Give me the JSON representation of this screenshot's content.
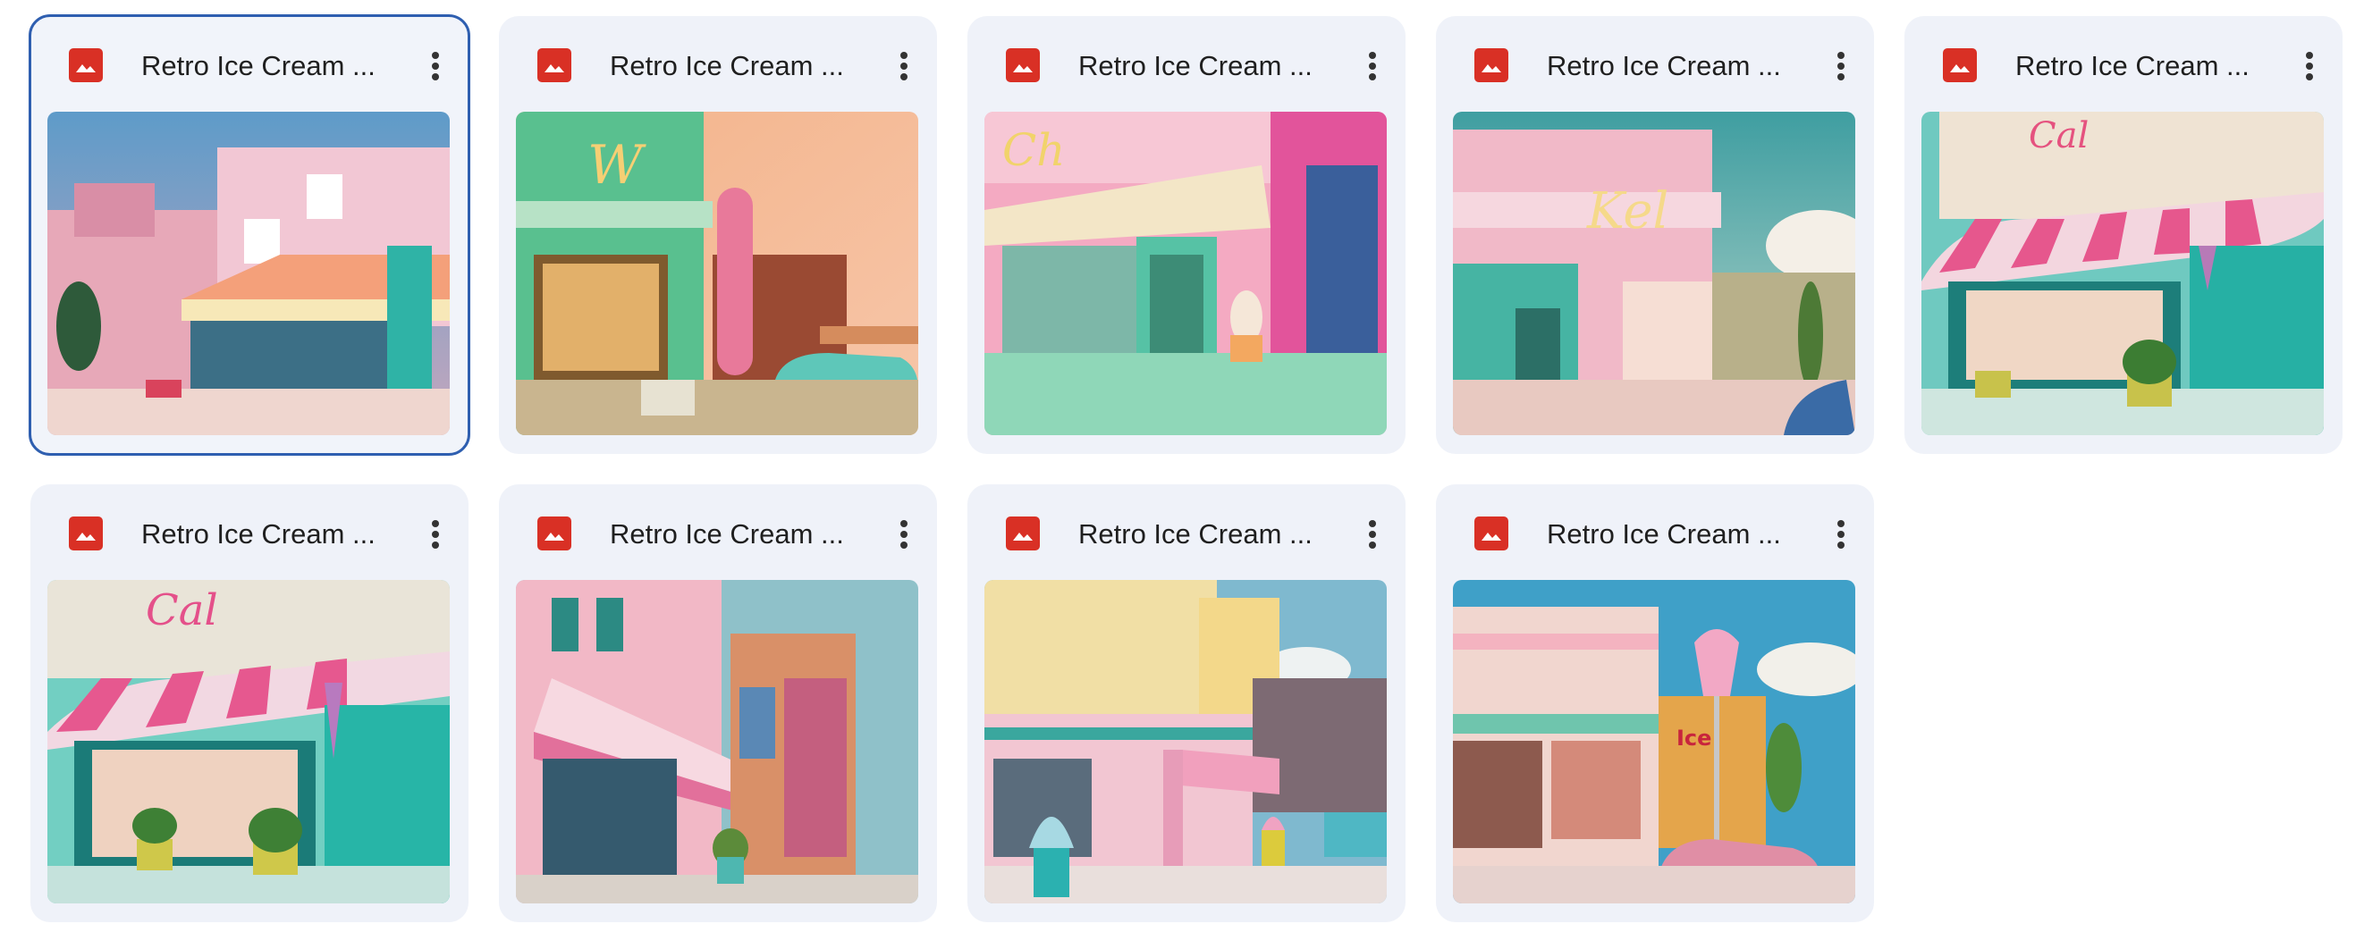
{
  "files": [
    {
      "name": "Retro Ice Cream ...",
      "selected": true
    },
    {
      "name": "Retro Ice Cream ...",
      "selected": false
    },
    {
      "name": "Retro Ice Cream ...",
      "selected": false
    },
    {
      "name": "Retro Ice Cream ...",
      "selected": false
    },
    {
      "name": "Retro Ice Cream ...",
      "selected": false
    },
    {
      "name": "Retro Ice Cream ...",
      "selected": false
    },
    {
      "name": "Retro Ice Cream ...",
      "selected": false
    },
    {
      "name": "Retro Ice Cream ...",
      "selected": false
    },
    {
      "name": "Retro Ice Cream ...",
      "selected": false
    }
  ],
  "icons": {
    "file_type": "image-file-icon",
    "menu": "more-vert-icon"
  },
  "colors": {
    "selection_outline": "#2f5fb0",
    "card_background": "#eff2f9",
    "image_icon": "#d93025"
  }
}
